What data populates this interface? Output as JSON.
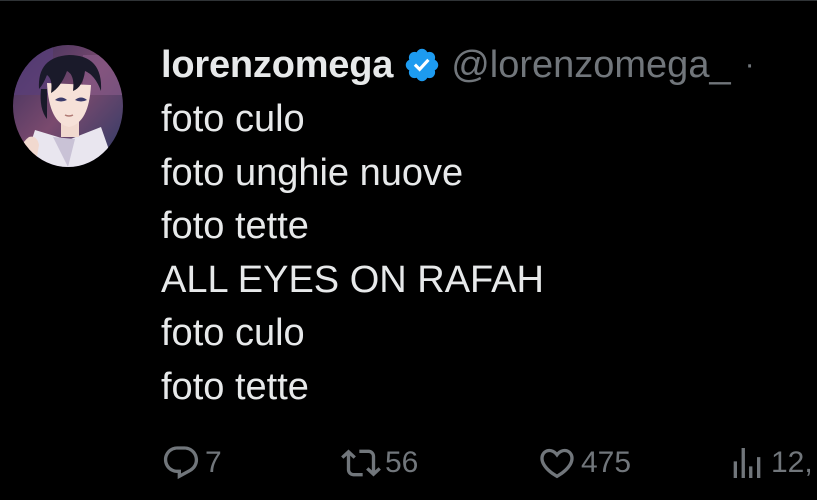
{
  "tweet": {
    "author": {
      "display_name": "lorenzomega",
      "handle": "@lorenzomega_",
      "separator": "·",
      "verified": true,
      "verified_color": "#1d9bf0"
    },
    "lines": [
      "foto culo",
      "foto unghie nuove",
      "foto tette",
      "ALL EYES ON RAFAH",
      "foto culo",
      "foto tette"
    ],
    "actions": {
      "reply": {
        "icon": "reply-icon",
        "count": "7"
      },
      "retweet": {
        "icon": "retweet-icon",
        "count": "56"
      },
      "like": {
        "icon": "heart-icon",
        "count": "475"
      },
      "views": {
        "icon": "views-icon",
        "count": "12,"
      }
    }
  },
  "colors": {
    "background": "#000000",
    "text_primary": "#e7e9ea",
    "text_secondary": "#71767b",
    "divider": "#2f3336"
  }
}
